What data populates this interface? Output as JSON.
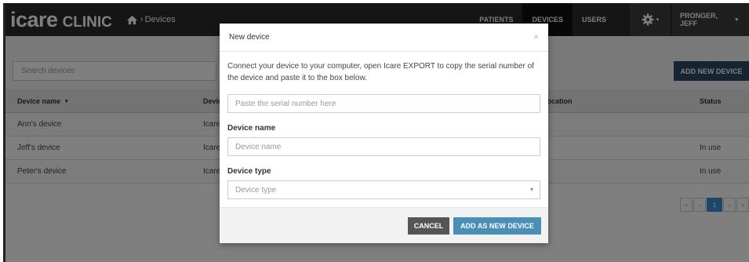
{
  "brand": {
    "name": "icare",
    "product": "CLINIC"
  },
  "breadcrumb": {
    "sep": "›",
    "current": "Devices"
  },
  "nav": {
    "patients": "PATIENTS",
    "devices": "DEVICES",
    "users": "USERS",
    "user_name": "PRONGER, JEFF",
    "caret": "▾"
  },
  "toolbar": {
    "search_placeholder": "Search devices",
    "add_device": "ADD NEW DEVICE"
  },
  "table": {
    "headers": {
      "name": "Device name",
      "sort_indicator": "▾",
      "type": "Device type",
      "location": "Location",
      "status": "Status"
    },
    "rows": [
      {
        "name": "Ann's device",
        "type": "Icare",
        "status": ""
      },
      {
        "name": "Jeff's device",
        "type": "Icare",
        "status": "In use"
      },
      {
        "name": "Peter's device",
        "type": "Icare",
        "status": "In use"
      }
    ]
  },
  "pager": {
    "first": "«",
    "prev": "‹",
    "current": "1",
    "next": "›",
    "last": "»"
  },
  "modal": {
    "title": "New device",
    "close": "×",
    "description": "Connect your device to your computer, open Icare EXPORT to copy the serial number of the device and paste it to the box below.",
    "serial_placeholder": "Paste the serial number here",
    "name_label": "Device name",
    "name_placeholder": "Device name",
    "type_label": "Device type",
    "type_placeholder": "Device type",
    "cancel": "CANCEL",
    "submit": "ADD AS NEW DEVICE"
  }
}
